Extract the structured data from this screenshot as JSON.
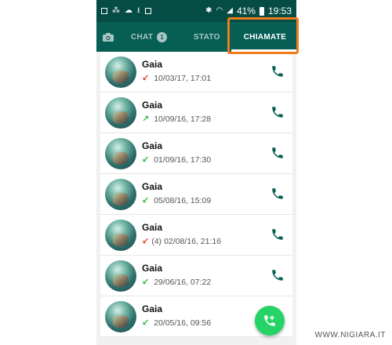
{
  "status_bar": {
    "icons_left": [
      "image-icon",
      "signal-bars-icon",
      "cloud-icon",
      "download-icon",
      "mail-icon"
    ],
    "icons_right": [
      "bluetooth-icon",
      "wifi-icon",
      "cell-signal-icon",
      "battery-icon"
    ],
    "battery": "41%",
    "time": "19:53"
  },
  "tabs": {
    "camera_icon": "camera-icon",
    "chat_label": "CHAT",
    "chat_badge": "1",
    "stato_label": "STATO",
    "chiamate_label": "CHIAMATE"
  },
  "calls": [
    {
      "name": "Gaia",
      "direction": "missed",
      "count": "",
      "datetime": "10/03/17, 17:01"
    },
    {
      "name": "Gaia",
      "direction": "out",
      "count": "",
      "datetime": "10/09/16, 17:28"
    },
    {
      "name": "Gaia",
      "direction": "in",
      "count": "",
      "datetime": "01/09/16, 17:30"
    },
    {
      "name": "Gaia",
      "direction": "in",
      "count": "",
      "datetime": "05/08/16, 15:09"
    },
    {
      "name": "Gaia",
      "direction": "missed",
      "count": "(4)",
      "datetime": "02/08/16, 21:16"
    },
    {
      "name": "Gaia",
      "direction": "in",
      "count": "",
      "datetime": "29/06/16, 07:22"
    },
    {
      "name": "Gaia",
      "direction": "in",
      "count": "",
      "datetime": "20/05/16, 09:56"
    }
  ],
  "colors": {
    "toolbar": "#075e54",
    "statusbar": "#054d44",
    "accent_green": "#25d366",
    "highlight": "#f07b1b",
    "missed": "#e0433c",
    "received": "#2db742"
  },
  "watermark": "WWW.NIGIARA.IT"
}
